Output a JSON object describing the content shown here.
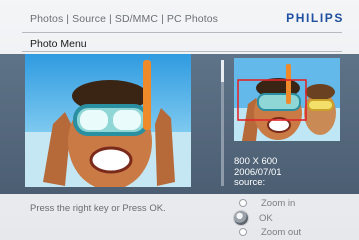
{
  "header": {
    "breadcrumb": "Photos | Source | SD/MMC | PC Photos",
    "brand": "PHILIPS"
  },
  "menu": {
    "title": "Photo Menu"
  },
  "info": {
    "resolution": "800 X 600",
    "date": "2006/07/01",
    "source_label": "source:"
  },
  "status": {
    "hint": "Press the right key or Press OK."
  },
  "controls": {
    "zoom_in": "Zoom in",
    "ok": "OK",
    "zoom_out": "Zoom out"
  },
  "colors": {
    "brand": "#1f4fa0",
    "panel": "#56697e",
    "crop_box": "#e0262a"
  },
  "icons": {
    "main_photo": "photo-image",
    "thumbnail": "photo-thumbnail-image",
    "ok_button": "round-ok-knob"
  }
}
